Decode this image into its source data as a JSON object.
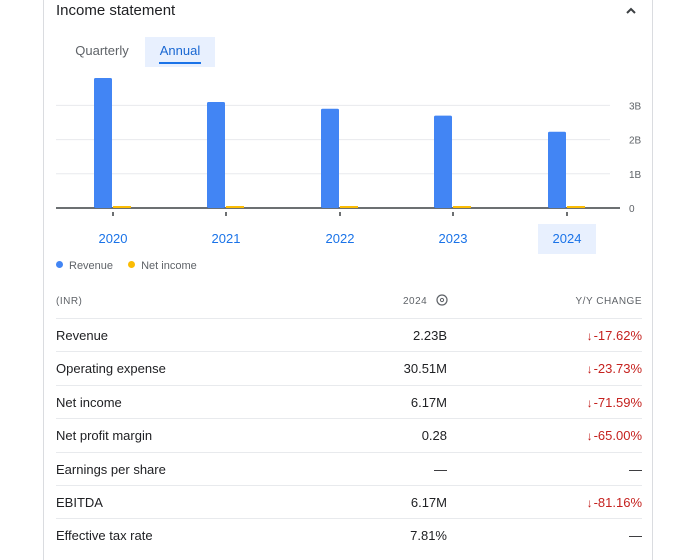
{
  "header": {
    "title": "Income statement",
    "collapse_icon": "chevron-up-icon"
  },
  "tabs": [
    {
      "label": "Quarterly",
      "selected": false
    },
    {
      "label": "Annual",
      "selected": true
    }
  ],
  "colors": {
    "revenue": "#4285f4",
    "net_income": "#fbbc04",
    "accent": "#1a73e8",
    "negative": "#c5221f"
  },
  "chart_data": {
    "type": "bar",
    "categories": [
      "2020",
      "2021",
      "2022",
      "2023",
      "2024"
    ],
    "selected_category": "2024",
    "series": [
      {
        "name": "Revenue",
        "values": [
          3.8,
          3.1,
          2.9,
          2.7,
          2.23
        ]
      },
      {
        "name": "Net income",
        "values": [
          0.04,
          0.03,
          0.03,
          0.04,
          0.006
        ]
      }
    ],
    "ylim": [
      0,
      3.8
    ],
    "y_ticks": [
      {
        "value": 0,
        "label": "0"
      },
      {
        "value": 1,
        "label": "1B"
      },
      {
        "value": 2,
        "label": "2B"
      },
      {
        "value": 3,
        "label": "3B"
      }
    ],
    "grid": true,
    "legend_position": "bottom-left"
  },
  "legend": [
    {
      "label": "Revenue"
    },
    {
      "label": "Net income"
    }
  ],
  "table": {
    "col_label": "(INR)",
    "col_year": "2024",
    "col_change": "Y/Y CHANGE",
    "info_icon": "info-icon",
    "rows": [
      {
        "label": "Revenue",
        "value": "2.23B",
        "change": "-17.62%",
        "trend": "down"
      },
      {
        "label": "Operating expense",
        "value": "30.51M",
        "change": "-23.73%",
        "trend": "down"
      },
      {
        "label": "Net income",
        "value": "6.17M",
        "change": "-71.59%",
        "trend": "down"
      },
      {
        "label": "Net profit margin",
        "value": "0.28",
        "change": "-65.00%",
        "trend": "down"
      },
      {
        "label": "Earnings per share",
        "value": "—",
        "change": "—",
        "trend": "none"
      },
      {
        "label": "EBITDA",
        "value": "6.17M",
        "change": "-81.16%",
        "trend": "down"
      },
      {
        "label": "Effective tax rate",
        "value": "7.81%",
        "change": "—",
        "trend": "none"
      }
    ]
  }
}
